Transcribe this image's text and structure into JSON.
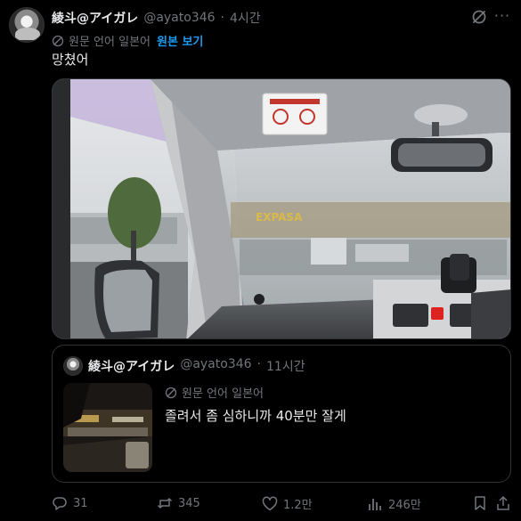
{
  "author": {
    "display_name": "綾斗@アイガレ",
    "handle": "@ayato346",
    "separator": "·",
    "time": "4시간"
  },
  "translation": {
    "source_label": "원문 언어 일본어",
    "show_original_label": "원본 보기"
  },
  "tweet": {
    "text": "망쳤어"
  },
  "media": {
    "sign_text": "EXPASA"
  },
  "quoted_tweet": {
    "display_name": "綾斗@アイガレ",
    "handle": "@ayato346",
    "separator": "·",
    "time": "11시간",
    "translation_label": "원문 언어 일본어",
    "text": "졸려서 좀 심하니까 40분만 잘게"
  },
  "actions": {
    "replies": "31",
    "reposts": "345",
    "likes": "1.2만",
    "views": "246만"
  },
  "icons": [
    "grok-icon",
    "more-icon",
    "globe-icon",
    "reply-icon",
    "repost-icon",
    "like-icon",
    "views-icon",
    "bookmark-icon",
    "share-icon"
  ],
  "colors": {
    "accent": "#1d9bf0",
    "muted": "#71767b",
    "text": "#e7e9ea",
    "background": "#000000"
  }
}
